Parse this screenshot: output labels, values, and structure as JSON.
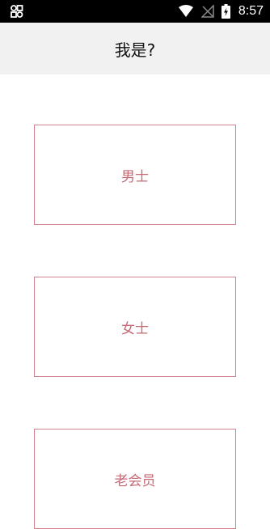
{
  "status_bar": {
    "time": "8:57",
    "left_icon": "notification-app-icon",
    "icons": [
      "wifi-icon",
      "no-signal-icon",
      "battery-charging-icon"
    ]
  },
  "header": {
    "title": "我是?"
  },
  "options": [
    {
      "label": "男士"
    },
    {
      "label": "女士"
    },
    {
      "label": "老会员"
    }
  ],
  "colors": {
    "accent": "#d4838e",
    "accent_text": "#c66a76",
    "header_bg": "#f1f1f1",
    "status_bg": "#000000"
  }
}
